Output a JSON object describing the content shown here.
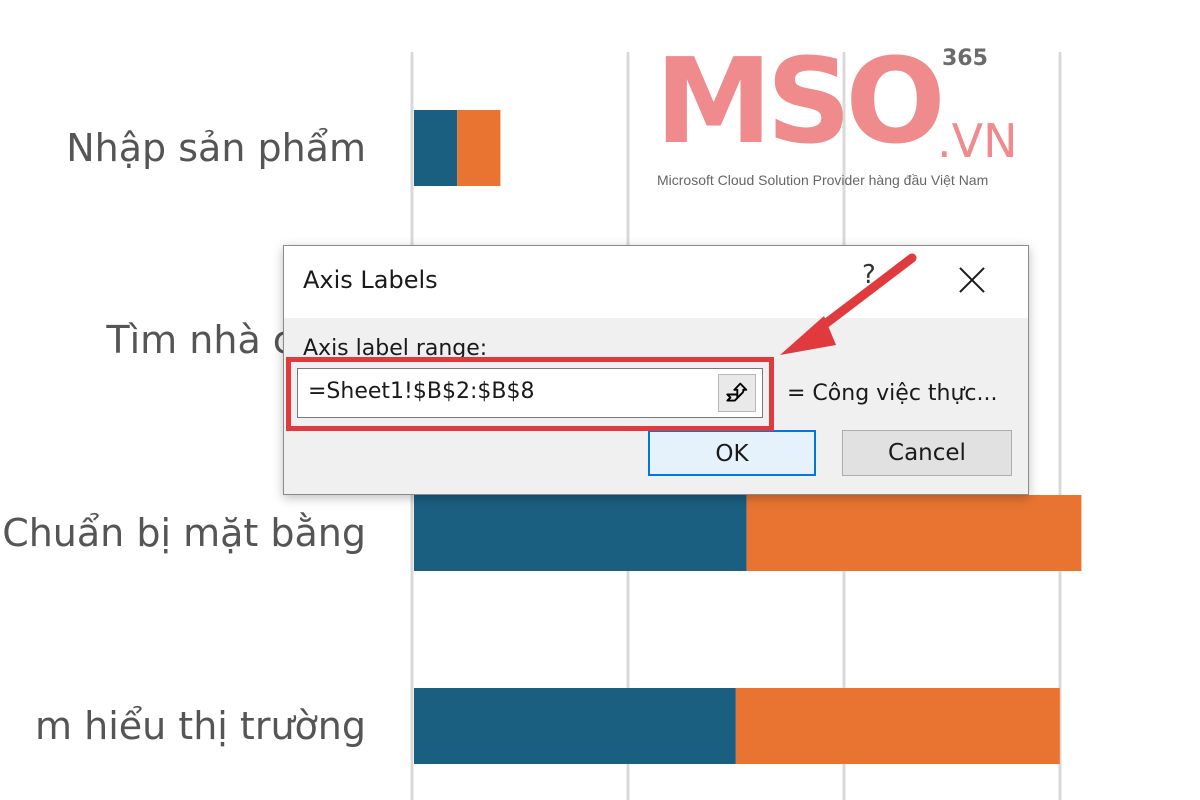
{
  "chart_data": {
    "type": "bar",
    "orientation": "horizontal",
    "stacked": true,
    "categories": [
      "Nhập sản phẩm",
      "Tìm nhà cung",
      "Chuẩn bị mặt bằng",
      "m hiểu thị trường"
    ],
    "series": [
      {
        "values": [
          2,
          null,
          15.4,
          14.9
        ]
      },
      {
        "values": [
          2,
          null,
          15.5,
          15.0
        ]
      }
    ],
    "xlim": [
      0,
      31
    ],
    "grid": true,
    "colors": [
      "#1a5e80",
      "#e97432"
    ]
  },
  "logo": {
    "main": "MSO",
    "suffix": ".VN",
    "superscript": "365",
    "tagline": "Microsoft Cloud Solution Provider hàng đầu Việt Nam",
    "color": "#ef8a8d"
  },
  "dialog": {
    "title": "Axis Labels",
    "help": "?",
    "close_icon": "close-icon",
    "range_label": "Axis label range:",
    "range_value": "=Sheet1!$B$2:$B$8",
    "collapse_icon": "upload-arrow-icon",
    "preview": "= Công việc thực...",
    "ok_label": "OK",
    "cancel_label": "Cancel"
  },
  "annotation": {
    "color": "#e03a3e",
    "arrow_icon": "arrow-icon"
  }
}
